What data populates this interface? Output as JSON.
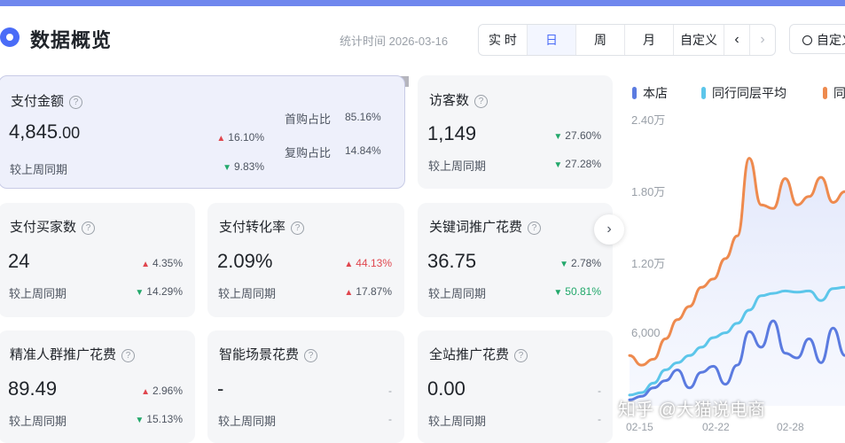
{
  "header": {
    "title": "数据概览",
    "stat_time": "统计时间 2026-03-16",
    "segments": [
      "实 时",
      "日",
      "周",
      "月",
      "自定义"
    ],
    "active_segment": "日",
    "prev_arrow": "‹",
    "next_arrow": "›",
    "custom_button": "自定义"
  },
  "cards": {
    "payment_amount": {
      "title": "支付金额",
      "value_main": "4,845",
      "value_decimal": ".00",
      "compare_label": "较上周同期",
      "change_up": "16.10%",
      "change_down": "9.83%",
      "first_purchase_label": "首购占比",
      "first_purchase_value": "85.16%",
      "repeat_purchase_label": "复购占比",
      "repeat_purchase_value": "14.84%"
    },
    "visitors": {
      "title": "访客数",
      "value": "1,149",
      "compare_label": "较上周同期",
      "change1": "27.60%",
      "change2": "27.28%"
    },
    "buyers": {
      "title": "支付买家数",
      "value": "24",
      "compare_label": "较上周同期",
      "change1": "4.35%",
      "change2": "14.29%"
    },
    "conversion": {
      "title": "支付转化率",
      "value": "2.09%",
      "compare_label": "较上周同期",
      "change1": "44.13%",
      "change2": "17.87%"
    },
    "keyword_ads": {
      "title": "关键词推广花费",
      "value": "36.75",
      "compare_label": "较上周同期",
      "change1": "2.78%",
      "change2": "50.81%"
    },
    "crowd_ads": {
      "title": "精准人群推广花费",
      "value": "89.49",
      "compare_label": "较上周同期",
      "change1": "2.96%",
      "change2": "15.13%"
    },
    "scene_ads": {
      "title": "智能场景花费",
      "value": "-",
      "compare_label": "较上周同期",
      "change1": "-",
      "change2": "-"
    },
    "site_ads": {
      "title": "全站推广花费",
      "value": "0.00",
      "compare_label": "较上周同期",
      "change1": "-",
      "change2": "-"
    }
  },
  "icons": {
    "help": "?",
    "up": "▲",
    "down": "▼",
    "next": "›"
  },
  "colors": {
    "accent": "#4a6cf7",
    "up": "#e0464e",
    "down": "#22a86b",
    "store": "#5b7be0",
    "peer_avg": "#5cc6ea",
    "peer_top": "#ee8a4e"
  },
  "chart_data": {
    "type": "line",
    "title": "",
    "legend": [
      "本店",
      "同行同层平均",
      "同行"
    ],
    "yticks": [
      "2.40万",
      "1.80万",
      "1.20万",
      "6,000"
    ],
    "y_values": [
      24000,
      18000,
      12000,
      6000
    ],
    "ylim": [
      0,
      24000
    ],
    "xticks": [
      "02-15",
      "02-22",
      "02-28"
    ],
    "series": [
      {
        "name": "同行",
        "values": [
          4200,
          3400,
          3900,
          5600,
          7200,
          8300,
          9900,
          10600,
          12300,
          14200,
          20700,
          16800,
          16500,
          19000,
          16800,
          17500,
          19100,
          17000,
          17900
        ]
      },
      {
        "name": "同行同层平均",
        "values": [
          900,
          1100,
          1900,
          3000,
          3600,
          4200,
          4900,
          5700,
          6100,
          6900,
          8000,
          9200,
          9400,
          9600,
          9500,
          9600,
          8800,
          9800,
          9900
        ]
      },
      {
        "name": "本店",
        "values": [
          500,
          800,
          1500,
          2100,
          3000,
          1500,
          2800,
          3300,
          1800,
          3400,
          6200,
          4900,
          7100,
          4400,
          4000,
          5600,
          3600,
          6500,
          4200
        ]
      }
    ]
  },
  "watermark": "知乎 @大猫说电商"
}
